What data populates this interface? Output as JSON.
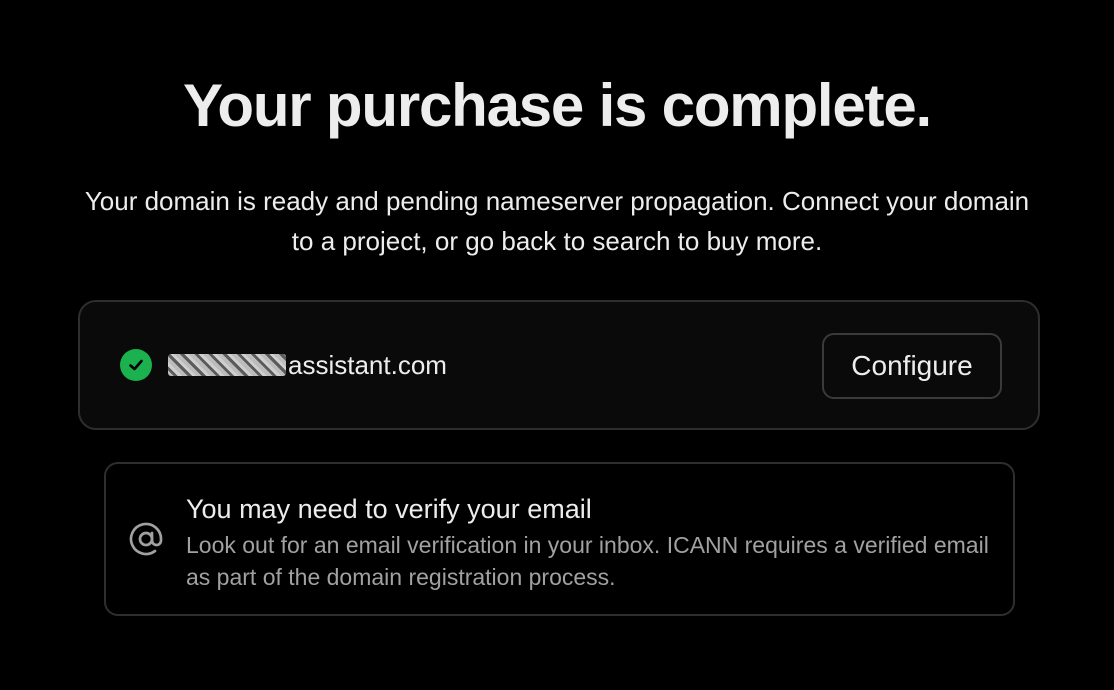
{
  "header": {
    "title": "Your purchase is complete.",
    "subtitle": "Your domain is ready and pending nameserver propagation. Connect your domain to a project, or go back to search to buy more."
  },
  "domain_card": {
    "status_icon": "check-circle-icon",
    "domain_suffix": "assistant.com",
    "configure_label": "Configure",
    "accent_color": "#1bb14e"
  },
  "notice": {
    "icon": "at-icon",
    "title": "You may need to verify your email",
    "body": "Look out for an email verification in your inbox. ICANN requires a verified email as part of the domain registration process."
  }
}
